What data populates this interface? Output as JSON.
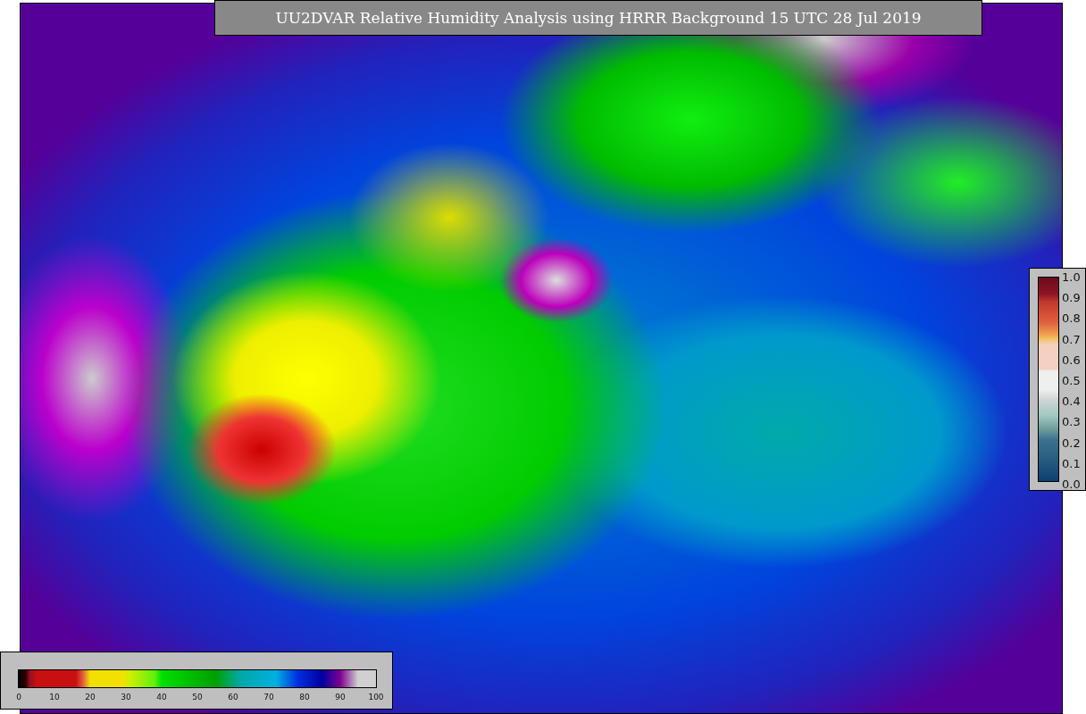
{
  "title": "UU2DVAR Relative Humidity Analysis using HRRR Background 15 UTC 28 Jul 2019",
  "colorbar_right": {
    "ticks": [
      "1.0",
      "0.9",
      "0.8",
      "0.7",
      "0.6",
      "0.5",
      "0.4",
      "0.3",
      "0.2",
      "0.1",
      "0.0"
    ]
  },
  "colorbar_bottom": {
    "ticks": [
      "0",
      "10",
      "20",
      "30",
      "40",
      "50",
      "60",
      "70",
      "80",
      "90",
      "100"
    ]
  }
}
